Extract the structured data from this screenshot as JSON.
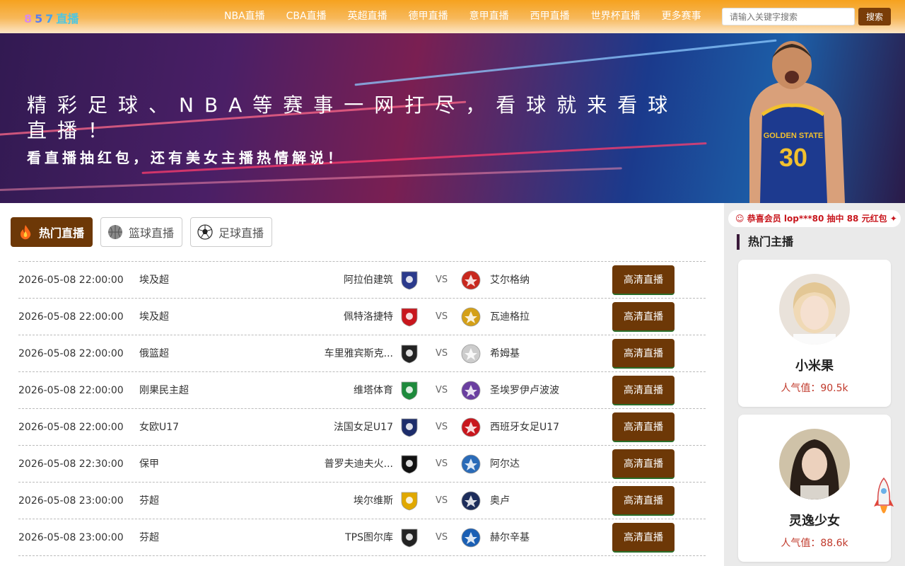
{
  "header": {
    "logo": {
      "d1": "8",
      "d2": "5",
      "d3": "7",
      "text": "直播"
    },
    "nav": [
      "NBA直播",
      "CBA直播",
      "英超直播",
      "德甲直播",
      "意甲直播",
      "西甲直播",
      "世界杯直播",
      "更多赛事"
    ],
    "search_placeholder": "请输入关键字搜索",
    "search_button": "搜索"
  },
  "banner": {
    "title": "精彩足球、NBA等赛事一网打尽，看球就来看球直播！",
    "subtitle": "看直播抽红包，还有美女主播热情解说！",
    "player_jersey_text": "GOLDEN STATE",
    "player_number": "30"
  },
  "tabs": [
    {
      "label": "热门直播",
      "icon": "fire-icon"
    },
    {
      "label": "篮球直播",
      "icon": "basketball-icon"
    },
    {
      "label": "足球直播",
      "icon": "soccer-ball-icon"
    }
  ],
  "matches": [
    {
      "time": "2026-05-08 22:00:00",
      "league": "埃及超",
      "home": "阿拉伯建筑",
      "away": "艾尔格纳",
      "button": "高清直播",
      "home_color": "#2b3a8c",
      "away_color": "#c8281e"
    },
    {
      "time": "2026-05-08 22:00:00",
      "league": "埃及超",
      "home": "佩特洛捷特",
      "away": "瓦迪格拉",
      "button": "高清直播",
      "home_color": "#c8161d",
      "away_color": "#d4a017"
    },
    {
      "time": "2026-05-08 22:00:00",
      "league": "俄篮超",
      "home": "车里雅宾斯克...",
      "away": "希姆基",
      "button": "高清直播",
      "home_color": "#222222",
      "away_color": "#cccccc"
    },
    {
      "time": "2026-05-08 22:00:00",
      "league": "刚果民主超",
      "home": "维塔体育",
      "away": "圣埃罗伊卢波波",
      "button": "高清直播",
      "home_color": "#1e8a3c",
      "away_color": "#6a3fa0"
    },
    {
      "time": "2026-05-08 22:00:00",
      "league": "女欧U17",
      "home": "法国女足U17",
      "away": "西班牙女足U17",
      "button": "高清直播",
      "home_color": "#1d2d6b",
      "away_color": "#c8161d"
    },
    {
      "time": "2026-05-08 22:30:00",
      "league": "保甲",
      "home": "普罗夫迪夫火...",
      "away": "阿尔达",
      "button": "高清直播",
      "home_color": "#111111",
      "away_color": "#2a6bb8"
    },
    {
      "time": "2026-05-08 23:00:00",
      "league": "芬超",
      "home": "埃尔维斯",
      "away": "奥卢",
      "button": "高清直播",
      "home_color": "#e0a800",
      "away_color": "#1d2d5b"
    },
    {
      "time": "2026-05-08 23:00:00",
      "league": "芬超",
      "home": "TPS图尔库",
      "away": "赫尔辛基",
      "button": "高清直播",
      "home_color": "#222222",
      "away_color": "#1a5fb4"
    }
  ],
  "sidebar": {
    "notice": "恭喜会员 lop***80 抽中 88 元红包",
    "title": "热门主播",
    "anchors": [
      {
        "name": "小米果",
        "popularity": "人气值：90.5k"
      },
      {
        "name": "灵逸少女",
        "popularity": "人气值：88.6k"
      }
    ]
  }
}
